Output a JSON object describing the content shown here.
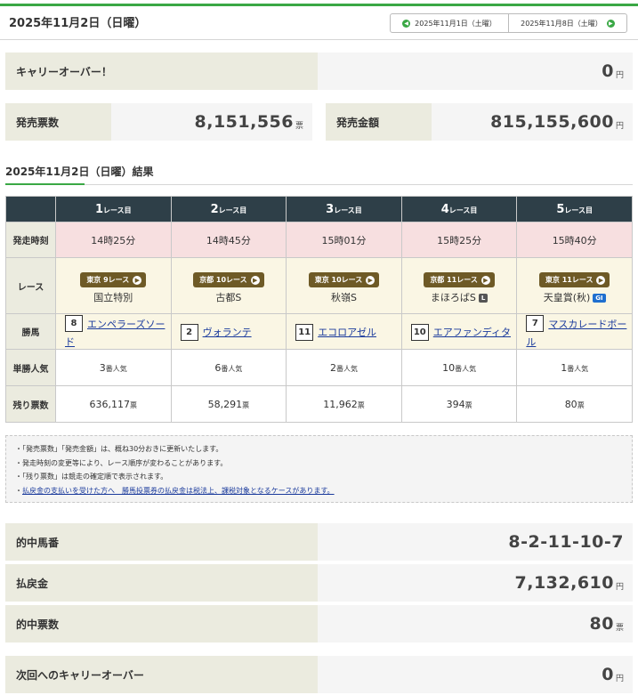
{
  "header": {
    "title": "2025年11月2日（日曜）",
    "prev_label": "2025年11月1日（土曜）",
    "next_label": "2025年11月8日（土曜）"
  },
  "carryover": {
    "label": "キャリーオーバー！",
    "value": "0",
    "unit": "円"
  },
  "sales": {
    "tickets_label": "発売票数",
    "tickets_value": "8,151,556",
    "tickets_unit": "票",
    "amount_label": "発売金額",
    "amount_value": "815,155,600",
    "amount_unit": "円"
  },
  "results": {
    "title": "2025年11月2日（日曜）結果",
    "row_labels": {
      "time": "発走時刻",
      "race": "レース",
      "winner": "勝馬",
      "popularity": "単勝人気",
      "remaining": "残り票数"
    },
    "races": [
      {
        "num": "1",
        "num_suffix": "レース目",
        "time": "14時25分",
        "venue": "東京 9レース",
        "name": "国立特別",
        "grade": "",
        "horse_no": "8",
        "horse": "エンペラーズソード",
        "pop": "3",
        "pop_suffix": "番人気",
        "left": "636,117",
        "left_unit": "票"
      },
      {
        "num": "2",
        "num_suffix": "レース目",
        "time": "14時45分",
        "venue": "京都 10レース",
        "name": "古都S",
        "grade": "",
        "horse_no": "2",
        "horse": "ヴォランテ",
        "pop": "6",
        "pop_suffix": "番人気",
        "left": "58,291",
        "left_unit": "票"
      },
      {
        "num": "3",
        "num_suffix": "レース目",
        "time": "15時01分",
        "venue": "東京 10レース",
        "name": "秋嶺S",
        "grade": "",
        "horse_no": "11",
        "horse": "エコロアゼル",
        "pop": "2",
        "pop_suffix": "番人気",
        "left": "11,962",
        "left_unit": "票"
      },
      {
        "num": "4",
        "num_suffix": "レース目",
        "time": "15時25分",
        "venue": "京都 11レース",
        "name": "まほろばS",
        "grade": "L",
        "horse_no": "10",
        "horse": "エアファンディタ",
        "pop": "10",
        "pop_suffix": "番人気",
        "left": "394",
        "left_unit": "票"
      },
      {
        "num": "5",
        "num_suffix": "レース目",
        "time": "15時40分",
        "venue": "東京 11レース",
        "name": "天皇賞(秋)",
        "grade": "GI",
        "horse_no": "7",
        "horse": "マスカレードボール",
        "pop": "1",
        "pop_suffix": "番人気",
        "left": "80",
        "left_unit": "票"
      }
    ]
  },
  "notes": [
    "「発売票数」「発売金額」は、概ね30分おきに更新いたします。",
    "発走時刻の変更等により、レース順序が変わることがあります。",
    "「残り票数」は競走の確定順で表示されます。",
    "払戻金の支払いを受けた方へ　勝馬投票券の払戻金は税法上、課税対象となるケースがあります。"
  ],
  "summary": {
    "winning_numbers_label": "的中馬番",
    "winning_numbers_value": "8-2-11-10-7",
    "payout_label": "払戻金",
    "payout_value": "7,132,610",
    "payout_unit": "円",
    "winning_tickets_label": "的中票数",
    "winning_tickets_value": "80",
    "winning_tickets_unit": "票",
    "next_carry_label": "次回へのキャリーオーバー",
    "next_carry_value": "0",
    "next_carry_unit": "円"
  },
  "colors": {
    "accent_green": "#3aa845",
    "header_dark": "#2e3f48",
    "badge_brown": "#6e5a26",
    "time_pink": "#f7dfe0",
    "label_beige": "#ebebdf",
    "link_blue": "#1a3a9c"
  },
  "icons": {
    "prev": "chevron-left-circle-icon",
    "next": "chevron-right-circle-icon",
    "race_link": "chevron-right-circle-icon"
  }
}
